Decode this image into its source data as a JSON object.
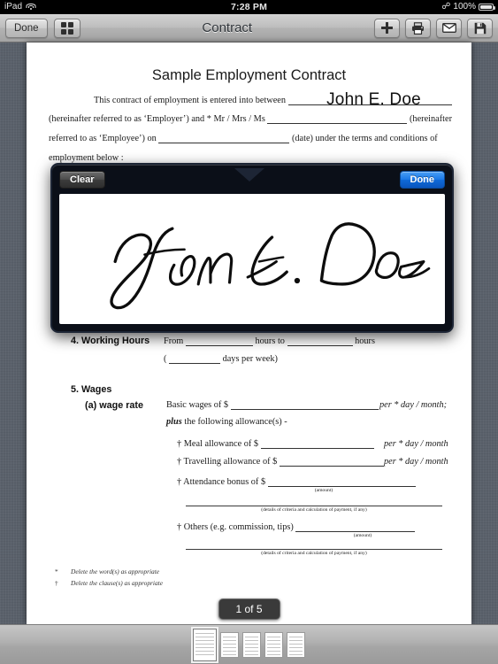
{
  "status_bar": {
    "device": "iPad",
    "wifi_icon": "wifi-icon",
    "time": "7:28 PM",
    "bluetooth_icon": "bluetooth-icon",
    "battery_percent": "100%",
    "battery_icon": "battery-icon"
  },
  "toolbar": {
    "done_label": "Done",
    "grid_icon": "grid-view-icon",
    "title": "Contract",
    "add_icon": "plus-icon",
    "print_icon": "printer-icon",
    "mail_icon": "envelope-icon",
    "save_icon": "floppy-disk-save-icon"
  },
  "document": {
    "title": "Sample Employment Contract",
    "signed_name": "John E. Doe",
    "intro": {
      "line1_pre": "This contract of employment is entered into between",
      "line2_pre": "(hereinafter referred to as ‘Employer’) and * Mr / Mrs / Ms",
      "line2_post": "(hereinafter",
      "line3_pre": "referred to as ‘Employee’) on",
      "line3_post": "(date) under the terms and conditions of",
      "line4": "employment below :"
    },
    "section4": {
      "heading": "4. Working Hours",
      "from_label": "From",
      "hours_to_label": "hours to",
      "hours_label": "hours",
      "days_open": "(",
      "days_label": "days per week)"
    },
    "section5": {
      "heading": "5. Wages",
      "subheading": "(a) wage rate",
      "basic_wages": "Basic wages of $",
      "basic_per": "per * day / month;",
      "plus_word": "plus",
      "plus_rest": "the following allowance(s) -",
      "meal": "† Meal allowance of $",
      "meal_per": "per * day / month",
      "travel": "† Travelling allowance of $",
      "travel_per": "per * day / month",
      "attendance": "† Attendance bonus of $",
      "amount_caption": "(amount)",
      "details_caption": "(details of criteria and calculation of payment, if any)",
      "others": "† Others (e.g. commission, tips)"
    },
    "footnotes": [
      {
        "mark": "*",
        "text": "Delete the word(s) as appropriate"
      },
      {
        "mark": "†",
        "text": "Delete the clause(s) as appropriate"
      }
    ]
  },
  "signature_modal": {
    "clear_label": "Clear",
    "done_label": "Done",
    "signature_text": "John E. Doe"
  },
  "page_indicator": "1 of 5",
  "thumbnails": {
    "count": 5,
    "selected_index": 0
  },
  "colors": {
    "accent_blue": "#1a78e8",
    "modal_border": "#1d2535",
    "linen_background": "#5a616b"
  }
}
